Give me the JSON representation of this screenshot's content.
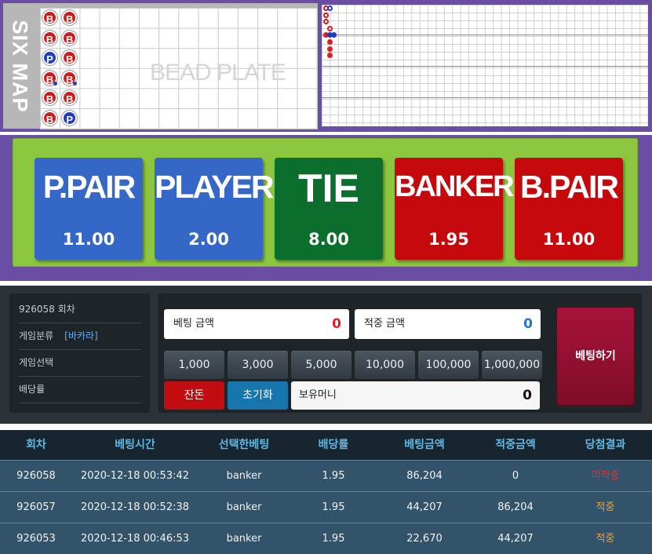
{
  "six_map": {
    "label": "SIX MAP",
    "title": "BEAD PLATE",
    "beads": [
      [
        "B",
        "B"
      ],
      [
        "B",
        "B"
      ],
      [
        "P",
        "B"
      ],
      [
        "B",
        "B"
      ],
      [
        "B",
        "B"
      ],
      [
        "B",
        "P"
      ]
    ]
  },
  "bet_options": [
    {
      "name": "P.PAIR",
      "odds": "11.00",
      "color": "#3467c8"
    },
    {
      "name": "PLAYER",
      "odds": "2.00",
      "color": "#3467c8"
    },
    {
      "name": "TIE",
      "odds": "8.00",
      "color": "#0c6e2d"
    },
    {
      "name": "BANKER",
      "odds": "1.95",
      "color": "#c4080c"
    },
    {
      "name": "B.PAIR",
      "odds": "11.00",
      "color": "#c4080c"
    }
  ],
  "game_info": {
    "round": "926058 회차",
    "type_label": "게임분류",
    "type_value": "[바카라]",
    "select_label": "게임선택",
    "odds_label": "배당률"
  },
  "bet_form": {
    "bet_amount_label": "베팅 금액",
    "bet_amount_value": "0",
    "win_amount_label": "적중 금액",
    "win_amount_value": "0",
    "chips": [
      "1,000",
      "3,000",
      "5,000",
      "10,000",
      "100,000",
      "1,000,000"
    ],
    "balance_button": "잔돈",
    "reset_button": "초기화",
    "wallet_label": "보유머니",
    "wallet_value": "0",
    "place_bet": "베팅하기"
  },
  "history": {
    "headers": [
      "회차",
      "베팅시간",
      "선택한베팅",
      "배당률",
      "베팅금액",
      "적중금액",
      "당첨결과"
    ],
    "rows": [
      [
        "926058",
        "2020-12-18 00:53:42",
        "banker",
        "1.95",
        "86,204",
        "0",
        "미적중"
      ],
      [
        "926057",
        "2020-12-18 00:52:38",
        "banker",
        "1.95",
        "44,207",
        "86,204",
        "적중"
      ],
      [
        "926053",
        "2020-12-18 00:46:53",
        "banker",
        "1.95",
        "22,670",
        "44,207",
        "적중"
      ]
    ],
    "result_colors": {
      "miss": "#e8302a",
      "hit": "#f0a23a"
    }
  }
}
